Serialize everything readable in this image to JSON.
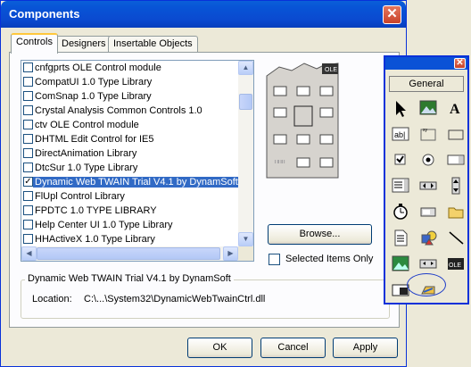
{
  "dialog": {
    "title": "Components",
    "tabs": [
      {
        "label": "Controls",
        "active": true
      },
      {
        "label": "Designers",
        "active": false
      },
      {
        "label": "Insertable Objects",
        "active": false
      }
    ],
    "list_items": [
      {
        "label": "cnfgprts OLE Control module",
        "checked": false,
        "selected": false
      },
      {
        "label": "CompatUI 1.0 Type Library",
        "checked": false,
        "selected": false
      },
      {
        "label": "ComSnap 1.0 Type Library",
        "checked": false,
        "selected": false
      },
      {
        "label": "Crystal Analysis Common Controls 1.0",
        "checked": false,
        "selected": false
      },
      {
        "label": "ctv OLE Control module",
        "checked": false,
        "selected": false
      },
      {
        "label": "DHTML Edit Control for IE5",
        "checked": false,
        "selected": false
      },
      {
        "label": "DirectAnimation Library",
        "checked": false,
        "selected": false
      },
      {
        "label": "DtcSur 1.0 Type Library",
        "checked": false,
        "selected": false
      },
      {
        "label": "Dynamic Web TWAIN Trial V4.1 by DynamSoft",
        "checked": true,
        "selected": true
      },
      {
        "label": "FlUpl Control Library",
        "checked": false,
        "selected": false
      },
      {
        "label": "FPDTC 1.0 TYPE LIBRARY",
        "checked": false,
        "selected": false
      },
      {
        "label": "Help Center UI 1.0 Type Library",
        "checked": false,
        "selected": false
      },
      {
        "label": "HHActiveX 1.0 Type Library",
        "checked": false,
        "selected": false
      }
    ],
    "browse_label": "Browse...",
    "selected_only_label": "Selected Items Only",
    "selected_only_checked": false,
    "group_title": "Dynamic Web TWAIN Trial V4.1 by DynamSoft",
    "location_label": "Location:",
    "location_value": "C:\\...\\System32\\DynamicWebTwainCtrl.dll",
    "ok_label": "OK",
    "cancel_label": "Cancel",
    "apply_label": "Apply"
  },
  "toolbox": {
    "general_label": "General",
    "tools": [
      "pointer-icon",
      "picture-box-icon",
      "label-icon",
      "textbox-icon",
      "frame-icon",
      "command-button-icon",
      "checkbox-icon",
      "option-button-icon",
      "combobox-icon",
      "listbox-icon",
      "hscrollbar-icon",
      "vscrollbar-icon",
      "timer-icon",
      "drive-list-icon",
      "dir-list-icon",
      "file-list-icon",
      "shape-icon",
      "line-icon",
      "image-icon",
      "data-icon",
      "ole-icon",
      "ole-small-icon",
      "dynamic-web-twain-icon"
    ]
  },
  "colors": {
    "title_bar": "#0a4ad0",
    "selection": "#316ac5",
    "tab_highlight": "#ffc83c"
  }
}
